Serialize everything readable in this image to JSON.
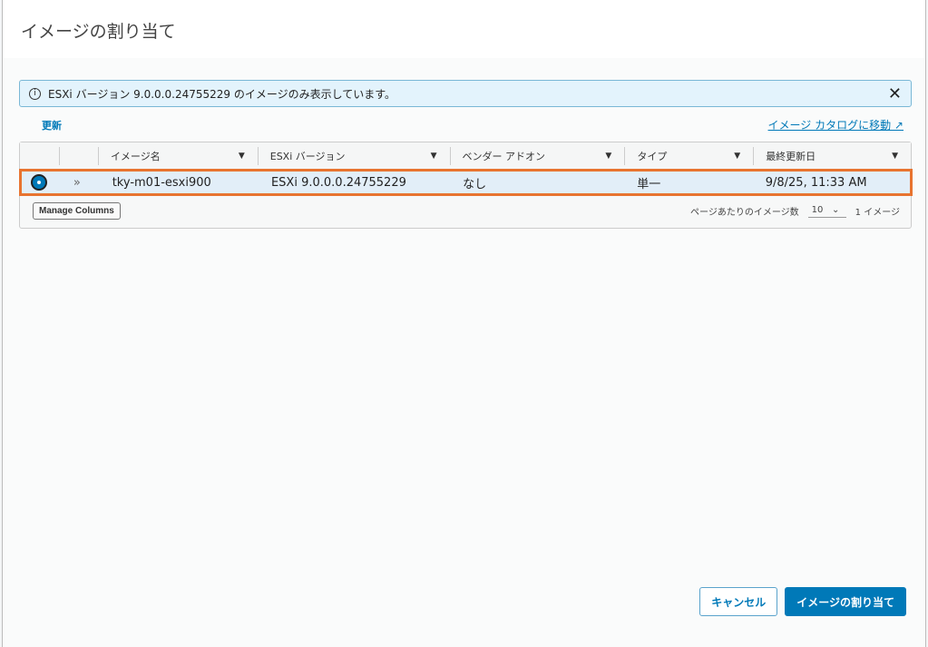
{
  "title": "イメージの割り当て",
  "alert": {
    "text": "ESXi バージョン 9.0.0.0.24755229 のイメージのみ表示しています。",
    "info": "i",
    "close": "✕"
  },
  "refresh": "更新",
  "catalog_link": "イメージ カタログに移動 ↗",
  "columns": [
    "イメージ名",
    "ESXi バージョン",
    "ベンダー アドオン",
    "タイプ",
    "最終更新日"
  ],
  "filter_glyph": "▼",
  "rows": [
    {
      "expand": "»",
      "name": "tky-m01-esxi900",
      "version": "ESXi 9.0.0.0.24755229",
      "vendor": "なし",
      "type": "単一",
      "updated": "9/8/25, 11:33 AM",
      "selected": true
    }
  ],
  "footer": {
    "manage_columns": "Manage Columns",
    "per_page_label": "ページあたりのイメージ数",
    "per_page": "10",
    "chevron": "⌄",
    "count": "1 イメージ"
  },
  "buttons": {
    "cancel": "キャンセル",
    "assign": "イメージの割り当て"
  }
}
